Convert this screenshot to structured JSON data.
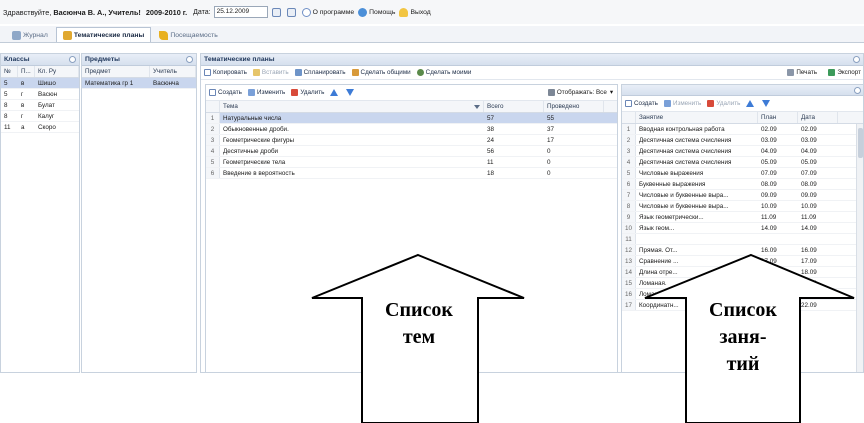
{
  "topbar": {
    "greeting_prefix": "Здравствуйте,",
    "user_name": "Васюнча В. А., Учитель!",
    "academic_year": "2009-2010 г.",
    "date_label": "Дата:",
    "date_value": "25.12.2009",
    "about_label": "О программе",
    "help_label": "Помощь",
    "exit_label": "Выход"
  },
  "tabs": [
    {
      "label": "Журнал",
      "icon": "journal-icon"
    },
    {
      "label": "Тематические планы",
      "icon": "plans-icon",
      "active": true
    },
    {
      "label": "Посещаемость",
      "icon": "attendance-icon"
    }
  ],
  "classes": {
    "title": "Классы",
    "columns": [
      "№",
      "П...",
      "Кл. Ру"
    ],
    "rows": [
      [
        "5",
        "в",
        "Шишо"
      ],
      [
        "5",
        "г",
        "Васюн"
      ],
      [
        "8",
        "в",
        "Булат"
      ],
      [
        "8",
        "г",
        "Калуг"
      ],
      [
        "11",
        "а",
        "Скоро"
      ]
    ]
  },
  "subjects": {
    "title": "Предметы",
    "columns": [
      "Предмет",
      "Учитель"
    ],
    "rows": [
      [
        "Математика гр 1",
        "Васюнча"
      ]
    ]
  },
  "themes_panel": {
    "title": "Тематические планы",
    "toolbar": {
      "copy": "Копировать",
      "paste": "Вставить",
      "plan": "Спланировать",
      "make_common": "Сделать общими",
      "make_mine": "Сделать моими",
      "print": "Печать",
      "export": "Экспорт"
    }
  },
  "topics": {
    "toolbar": {
      "create": "Создать",
      "edit": "Изменить",
      "delete": "Удалить",
      "show": "Отображать: Все"
    },
    "columns": [
      "Тема",
      "Всего",
      "Проведено"
    ],
    "rows": [
      [
        "1",
        "Натуральные числа",
        "57",
        "55"
      ],
      [
        "2",
        "Обыкновенные дроби.",
        "38",
        "37"
      ],
      [
        "3",
        "Геометрические фигуры",
        "24",
        "17"
      ],
      [
        "4",
        "Десятичные дроби",
        "56",
        "0"
      ],
      [
        "5",
        "Геометрические тела",
        "11",
        "0"
      ],
      [
        "6",
        "Введение в вероятность",
        "18",
        "0"
      ]
    ]
  },
  "lessons": {
    "toolbar": {
      "create": "Создать",
      "edit": "Изменить",
      "delete": "Удалить"
    },
    "columns": [
      "Занятие",
      "План",
      "Дата"
    ],
    "rows": [
      [
        "1",
        "Вводная контрольная работа",
        "02.09",
        "02.09"
      ],
      [
        "2",
        "Десятичная система счисления",
        "03.09",
        "03.09"
      ],
      [
        "3",
        "Десятичная система счисления",
        "04.09",
        "04.09"
      ],
      [
        "4",
        "Десятичная система счисления",
        "05.09",
        "05.09"
      ],
      [
        "5",
        "Числовые выражения",
        "07.09",
        "07.09"
      ],
      [
        "6",
        "Буквенные выражения",
        "08.09",
        "08.09"
      ],
      [
        "7",
        "Числовые и буквенные выра...",
        "09.09",
        "09.09"
      ],
      [
        "8",
        "Числовые и буквенные выра...",
        "10.09",
        "10.09"
      ],
      [
        "9",
        "Язык геометрически...",
        "11.09",
        "11.09"
      ],
      [
        "10",
        "Язык геом...",
        "14.09",
        "14.09"
      ],
      [
        "11",
        "",
        "",
        ""
      ],
      [
        "12",
        "Прямая. От...",
        "16.09",
        "16.09"
      ],
      [
        "13",
        "Сравнение ...",
        "17.09",
        "17.09"
      ],
      [
        "14",
        "Длина отре...",
        "18.09",
        "18.09"
      ],
      [
        "15",
        "Ломаная.",
        "19.09",
        "19.09"
      ],
      [
        "16",
        "Ломаная.",
        "21.09",
        "21.09"
      ],
      [
        "17",
        "Координатн...",
        "22.09",
        "22.09"
      ]
    ]
  },
  "callouts": {
    "topics_line1": "Список",
    "topics_line2": "тем",
    "lessons_line1": "Список",
    "lessons_line2": "заня-",
    "lessons_line3": "тий"
  }
}
